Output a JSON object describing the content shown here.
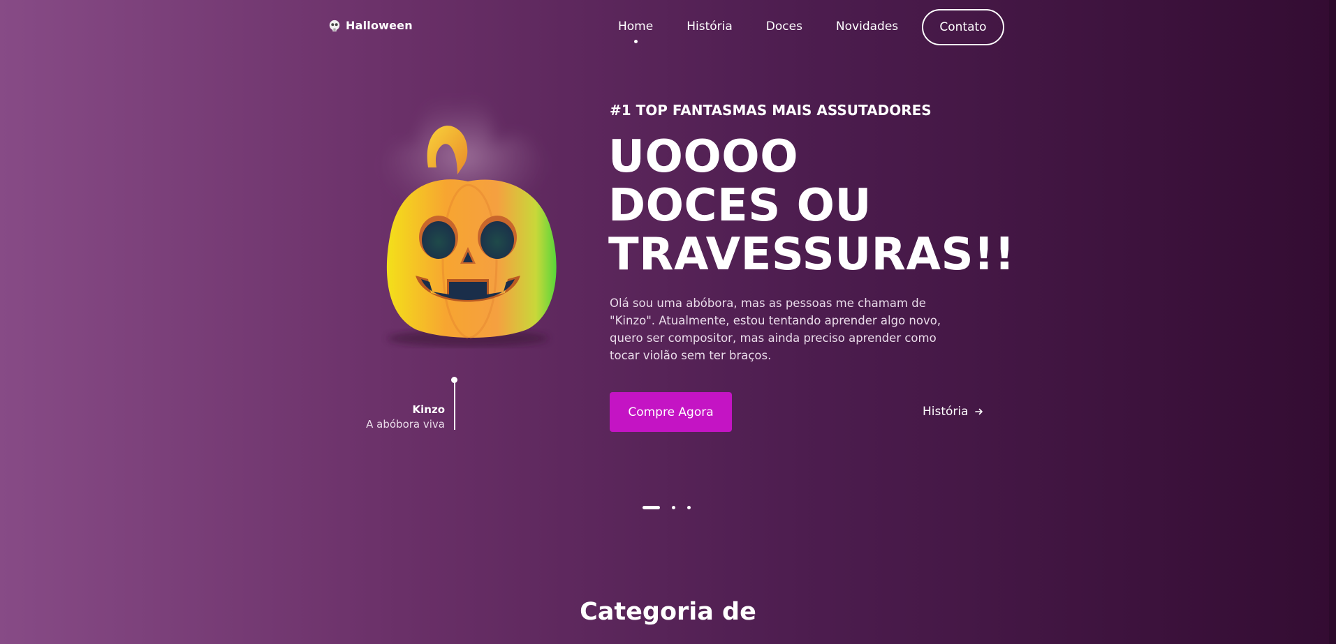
{
  "nav": {
    "logo_text": "Halloween",
    "logo_icon": "ghost-skull-icon",
    "items": [
      {
        "label": "Home",
        "active": true
      },
      {
        "label": "História",
        "active": false
      },
      {
        "label": "Doces",
        "active": false
      },
      {
        "label": "Novidades",
        "active": false
      }
    ],
    "contact_label": "Contato"
  },
  "hero": {
    "eyebrow": "#1 TOP FANTASMAS MAIS ASSUTADORES",
    "headline": [
      "UOOOO",
      "DOCES OU",
      "TRAVESSURAS!!"
    ],
    "description": "Olá sou uma abóbora, mas as pessoas me chamam de \"Kinzo\". Atualmente, estou tentando aprender algo novo, quero ser compositor, mas ainda preciso aprender como tocar violão sem ter braços.",
    "buy_label": "Compre Agora",
    "story_label": "História",
    "story_icon": "arrow-right-icon"
  },
  "character": {
    "name": "Kinzo",
    "subtitle": "A abóbora viva",
    "image": "jack-o-lantern-pumpkin"
  },
  "carousel": {
    "count": 3,
    "active_index": 0
  },
  "section": {
    "title": "Categoria de"
  },
  "colors": {
    "accent": "#c414c4",
    "bg_left": "#874b86",
    "bg_right": "#330c32"
  }
}
